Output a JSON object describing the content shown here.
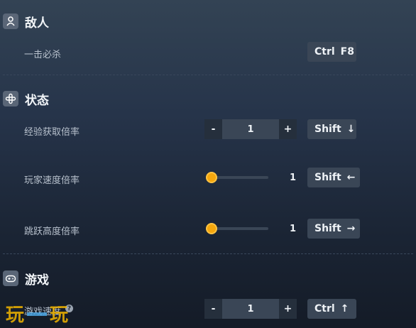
{
  "sections": {
    "enemy": {
      "title": "敌人",
      "icon": "person-icon",
      "rows": [
        {
          "label": "一击必杀",
          "hotkey": [
            "Ctrl",
            "F8"
          ]
        }
      ]
    },
    "status": {
      "title": "状态",
      "icon": "cross-icon",
      "rows": [
        {
          "label": "经验获取倍率",
          "control": "stepper",
          "minus": "-",
          "value": "1",
          "plus": "+",
          "hotkey": [
            "Shift",
            "↓"
          ]
        },
        {
          "label": "玩家速度倍率",
          "control": "slider",
          "value": "1",
          "level": 0,
          "hotkey": [
            "Shift",
            "←"
          ]
        },
        {
          "label": "跳跃高度倍率",
          "control": "slider",
          "value": "1",
          "level": 0,
          "hotkey": [
            "Shift",
            "→"
          ]
        }
      ]
    },
    "game": {
      "title": "游戏",
      "icon": "gamepad-icon",
      "rows": [
        {
          "label": "游戏速度",
          "control": "stepper",
          "minus": "-",
          "value": "1",
          "plus": "+",
          "hotkey": [
            "Ctrl",
            "↑"
          ],
          "info_icon": "info-icon"
        }
      ]
    }
  },
  "colors": {
    "accent": "#f5a70d",
    "button_bg": "#3a4656"
  },
  "watermark": {
    "text": "玩一玩"
  }
}
